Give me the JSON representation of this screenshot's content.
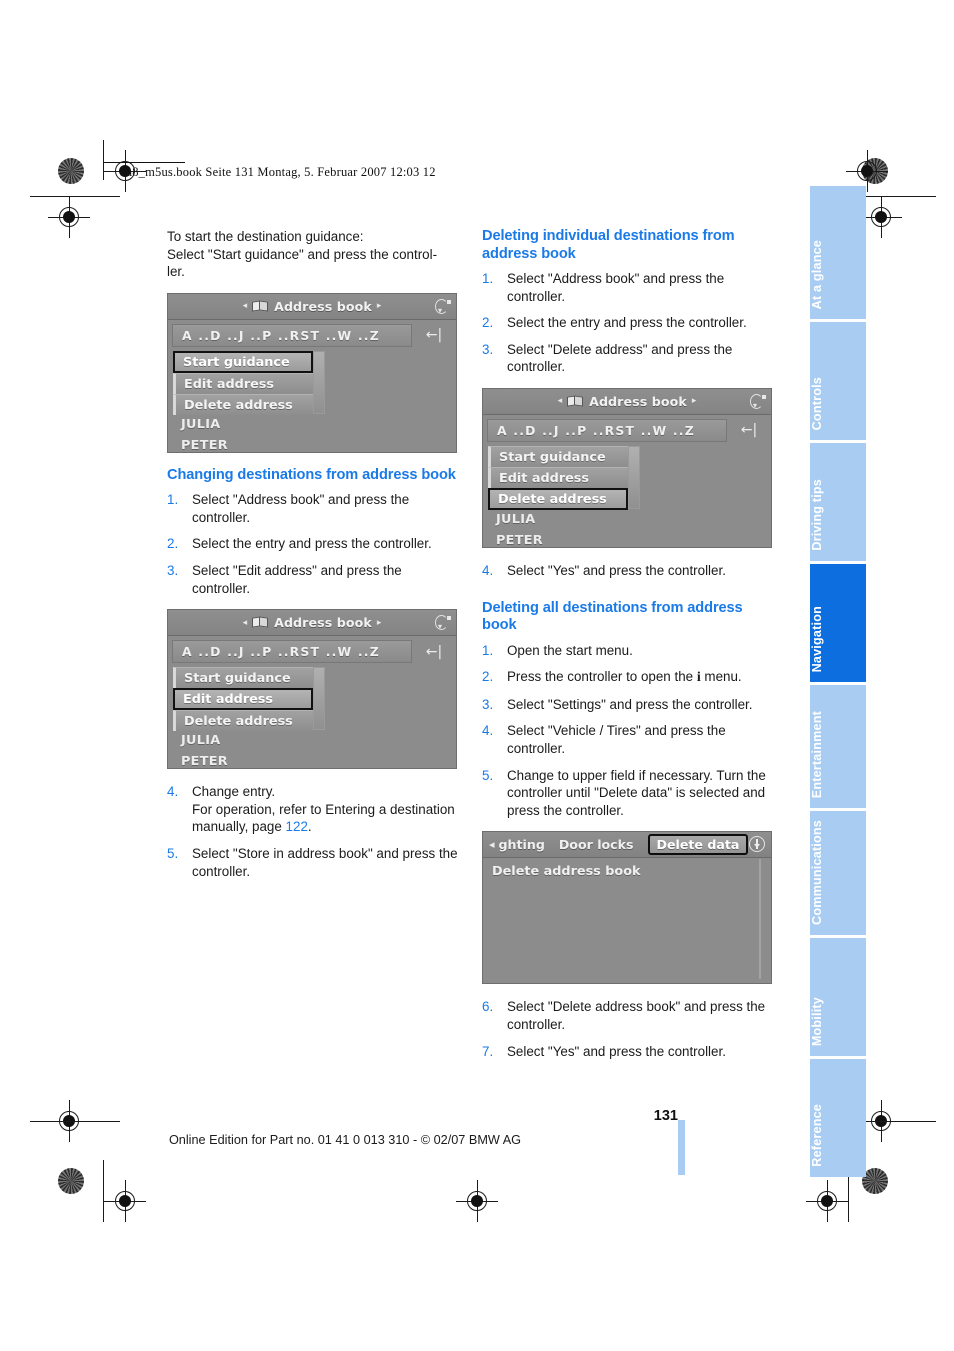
{
  "running_head": "ba8_m5us.book  Seite 131  Montag, 5. Februar 2007  12:03 12",
  "page_number": "131",
  "footer": "Online Edition for Part no. 01 41 0 013 310 - © 02/07 BMW AG",
  "colors": {
    "heading_blue": "#1a7ae8",
    "tab_blue": "#a9cdf2",
    "tab_active_blue": "#0d6ee0",
    "screen_gray": "#8c8c8c"
  },
  "left_column": {
    "intro": {
      "line1": "To start the destination guidance:",
      "line2": "Select \"Start guidance\" and press the control-",
      "line3": "ler."
    },
    "screen1": {
      "title": "Address book",
      "alpha_row": "A ..D ..J ..P ..RST ..W ..Z",
      "menu": [
        {
          "label": "Start guidance",
          "selected": true
        },
        {
          "label": "Edit address",
          "selected": false
        },
        {
          "label": "Delete address",
          "selected": false
        }
      ],
      "entries": [
        "JULIA",
        "PETER"
      ]
    },
    "section": {
      "heading": "Changing destinations from address book",
      "steps": [
        "Select \"Address book\" and press the controller.",
        "Select the entry and press the controller.",
        "Select \"Edit address\" and press the controller."
      ]
    },
    "screen2": {
      "title": "Address book",
      "alpha_row": "A ..D ..J ..P ..RST ..W ..Z",
      "menu": [
        {
          "label": "Start guidance",
          "selected": false
        },
        {
          "label": "Edit address",
          "selected": true
        },
        {
          "label": "Delete address",
          "selected": false
        }
      ],
      "entries": [
        "JULIA",
        "PETER"
      ]
    },
    "steps_after": {
      "step4_line1": "Change entry.",
      "step4_line2": "For operation, refer to Entering a destination manually, page ",
      "step4_xref": "122",
      "step4_end": ".",
      "step5": "Select \"Store in address book\" and press the controller."
    }
  },
  "right_column": {
    "section1": {
      "heading": "Deleting individual destinations from address book",
      "steps": [
        "Select \"Address book\" and press the controller.",
        "Select the entry and press the controller.",
        "Select \"Delete address\" and press the controller."
      ]
    },
    "screen3": {
      "title": "Address book",
      "alpha_row": "A ..D ..J ..P ..RST ..W ..Z",
      "menu": [
        {
          "label": "Start guidance",
          "selected": false
        },
        {
          "label": "Edit address",
          "selected": false
        },
        {
          "label": "Delete address",
          "selected": true
        }
      ],
      "entries": [
        "JULIA",
        "PETER"
      ]
    },
    "step4_after_screen": "Select \"Yes\" and press the controller.",
    "section2": {
      "heading": "Deleting all destinations from address book",
      "step1": "Open the start menu.",
      "step2_pre": "Press the controller to open the ",
      "step2_icon": "i",
      "step2_post": " menu.",
      "step3": "Select \"Settings\" and press the controller.",
      "step4": "Select \"Vehicle / Tires\" and press the controller.",
      "step5": "Change to upper field if necessary. Turn the controller until \"Delete data\" is selected and press the controller."
    },
    "screen4": {
      "tabs": [
        {
          "label": "ghting",
          "selected": false
        },
        {
          "label": "Door locks",
          "selected": false
        },
        {
          "label": "Delete data",
          "selected": true
        }
      ],
      "list": [
        "Delete address book"
      ]
    },
    "steps_final": {
      "step6": "Select \"Delete address book\" and press the controller.",
      "step7": "Select \"Yes\" and press the controller."
    }
  },
  "side_tabs": [
    {
      "label": "At a glance",
      "active": false
    },
    {
      "label": "Controls",
      "active": false
    },
    {
      "label": "Driving tips",
      "active": false
    },
    {
      "label": "Navigation",
      "active": true
    },
    {
      "label": "Entertainment",
      "active": false
    },
    {
      "label": "Communications",
      "active": false
    },
    {
      "label": "Mobility",
      "active": false
    },
    {
      "label": "Reference",
      "active": false
    }
  ]
}
